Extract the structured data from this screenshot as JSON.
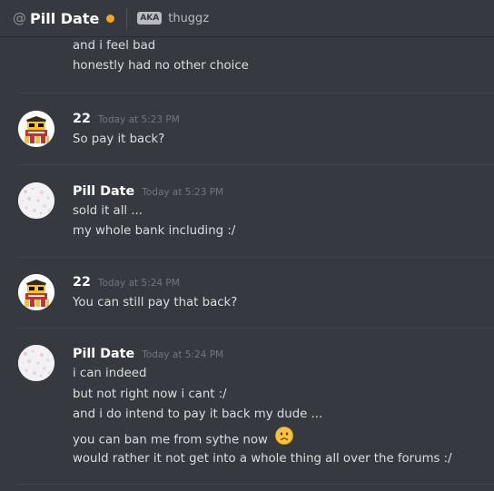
{
  "header": {
    "title": "Pill Date",
    "aka_label": "AKA",
    "aka_name": "thuggz",
    "status_color": "#faa61a"
  },
  "icons": {
    "at": "@",
    "status": "idle-status-dot",
    "avatar_22": "cartoon-character-avatar",
    "avatar_pill_date": "speckled-white-avatar",
    "emoji": "frowning-face-emoji"
  },
  "messages": [
    {
      "author": "",
      "time": "",
      "lines": [
        "and i feel bad",
        "honestly had no other choice"
      ]
    },
    {
      "author": "22",
      "time": "Today at 5:23 PM",
      "lines": [
        "So pay it back?"
      ]
    },
    {
      "author": "Pill Date",
      "time": "Today at 5:23 PM",
      "lines": [
        "sold it all ...",
        "my whole bank including :/"
      ]
    },
    {
      "author": "22",
      "time": "Today at 5:24 PM",
      "lines": [
        "You can still pay that back?"
      ]
    },
    {
      "author": "Pill Date",
      "time": "Today at 5:24 PM",
      "lines": [
        "i can indeed",
        "but not right now i cant :/",
        "and i do intend to pay it back my dude ...",
        "you can ban me from sythe now",
        "would rather it not get into a whole thing all over the forums :/"
      ]
    }
  ]
}
